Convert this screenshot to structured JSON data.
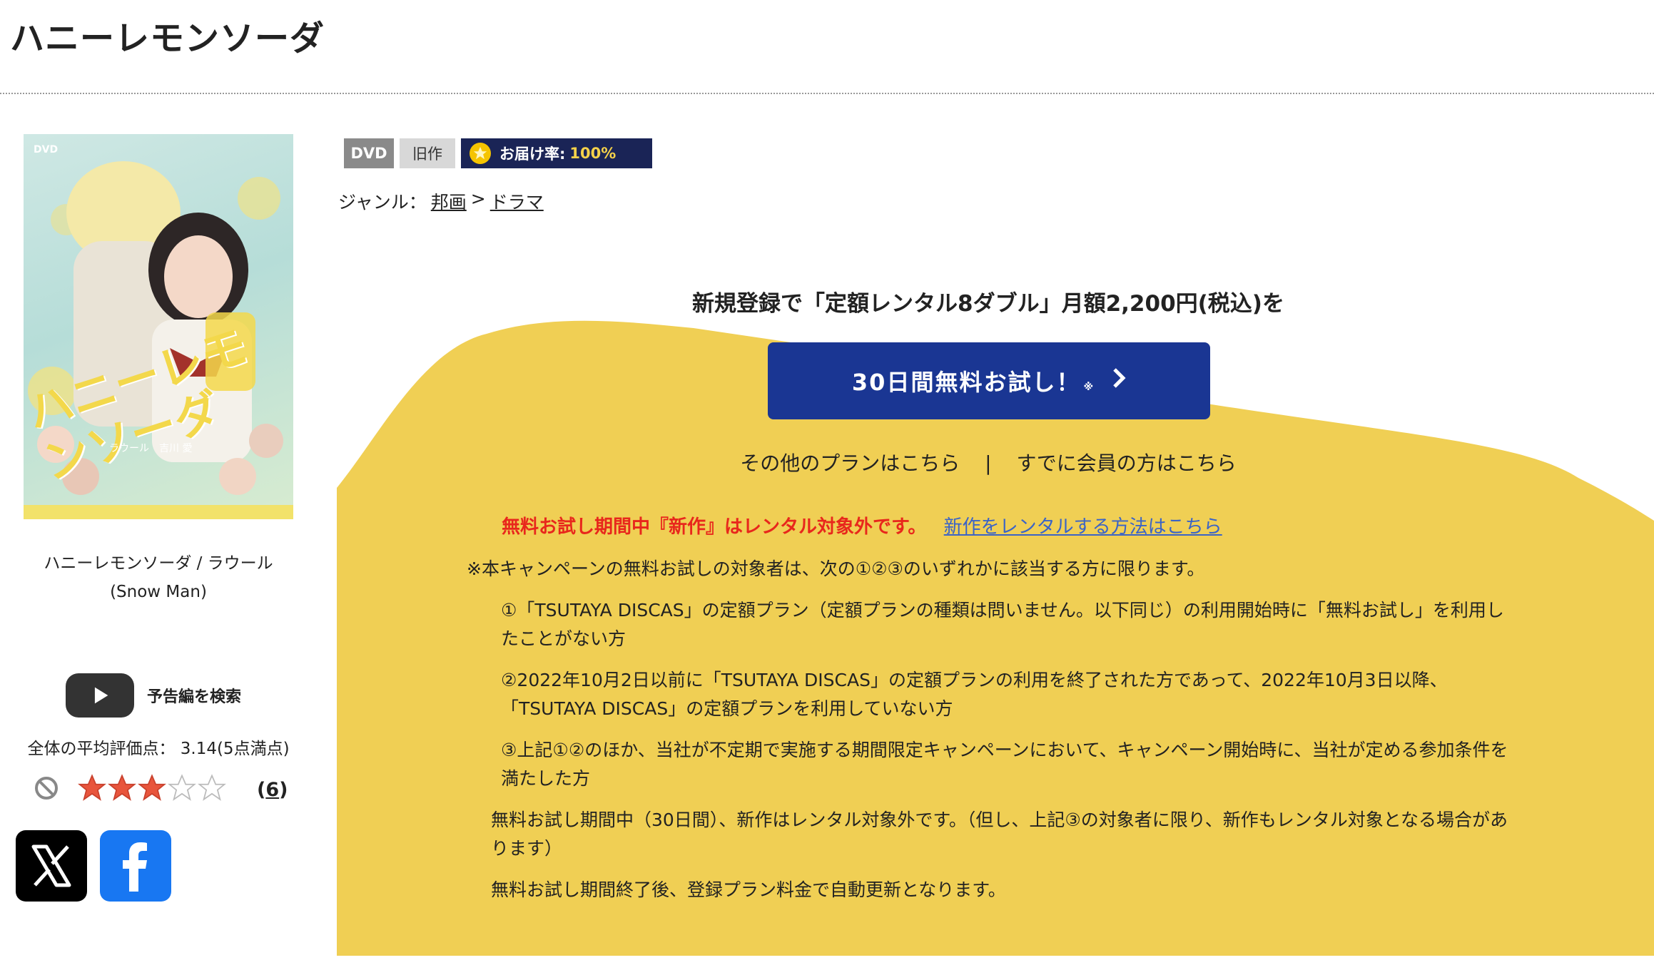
{
  "page": {
    "title": "ハニーレモンソーダ"
  },
  "cover": {
    "dvd_mark": "DVD",
    "title_art": "ハニーレモンソーダ",
    "cast_art": "ラウール　吉川 愛"
  },
  "product": {
    "caption": "ハニーレモンソーダ / ラウール (Snow Man)"
  },
  "trailer": {
    "label": "予告編を検索"
  },
  "rating": {
    "average_text": "全体の平均評価点： 3.14(5点満点)",
    "average": 3.14,
    "max": 5,
    "count_label": "6"
  },
  "badges": {
    "format": "DVD",
    "type": "旧作",
    "delivery_label": "お届け率:",
    "delivery_value": "100%"
  },
  "genre": {
    "label": "ジャンル：",
    "items": [
      "邦画",
      "ドラマ"
    ],
    "separator": ">"
  },
  "campaign": {
    "headline": "新規登録で「定額レンタル8ダブル」月額2,200円(税込)を",
    "button_label": "30日間無料お試し！",
    "button_note": "※",
    "other_plans": "その他のプランはこちら",
    "separator": "|",
    "member_link": "すでに会員の方はこちら",
    "notice_red": "無料お試し期間中『新作』はレンタル対象外です。",
    "notice_link": "新作をレンタルする方法はこちら",
    "colors": {
      "button": "#1a3693",
      "yellow": "#f0cf54",
      "notice": "#e8271c"
    }
  },
  "terms": {
    "intro": "※本キャンペーンの無料お試しの対象者は、次の①②③のいずれかに該当する方に限ります。",
    "items": [
      "①「TSUTAYA DISCAS」の定額プラン（定額プランの種類は問いません。以下同じ）の利用開始時に「無料お試し」を利用したことがない方",
      "②2022年10月2日以前に「TSUTAYA DISCAS」の定額プランの利用を終了された方であって、2022年10月3日以降、「TSUTAYA DISCAS」の定額プランを利用していない方",
      "③上記①②のほか、当社が不定期で実施する期間限定キャンペーンにおいて、キャンペーン開始時に、当社が定める参加条件を満たした方"
    ],
    "para1": "無料お試し期間中（30日間）、新作はレンタル対象外です。（但し、上記③の対象者に限り、新作もレンタル対象となる場合があります）",
    "para2": "無料お試し期間終了後、登録プラン料金で自動更新となります。"
  }
}
